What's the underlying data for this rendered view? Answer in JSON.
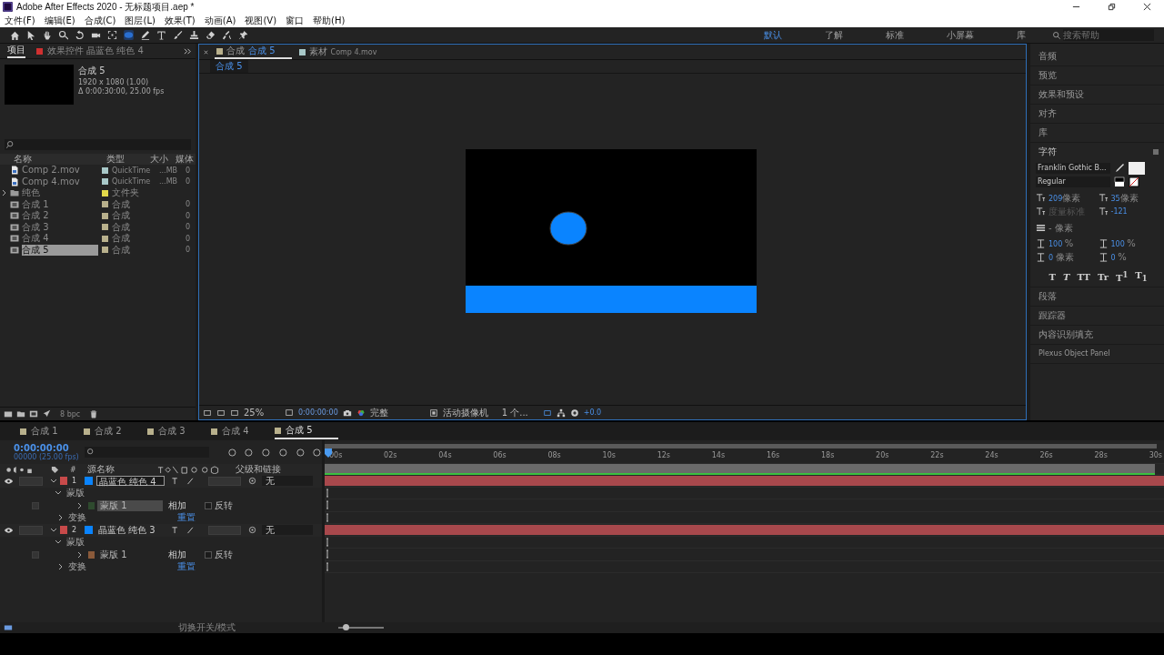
{
  "window": {
    "title": "Adobe After Effects 2020 - 无标题项目.aep *"
  },
  "menu": [
    "文件(F)",
    "编辑(E)",
    "合成(C)",
    "图层(L)",
    "效果(T)",
    "动画(A)",
    "视图(V)",
    "窗口",
    "帮助(H)"
  ],
  "workspaces": [
    {
      "label": "默认",
      "selected": true
    },
    {
      "label": "了解",
      "selected": false
    },
    {
      "label": "标准",
      "selected": false
    },
    {
      "label": "小屏幕",
      "selected": false
    },
    {
      "label": "库",
      "selected": false
    }
  ],
  "help_search": {
    "placeholder": "搜索帮助"
  },
  "project": {
    "tabs": [
      {
        "label": "项目",
        "selected": true
      },
      {
        "label": "效果控件 晶蓝色 纯色 4",
        "selected": false
      }
    ],
    "preview": {
      "name": "合成 5",
      "size": "1920 x 1080 (1.00)",
      "duration": "Δ 0:00:30:00, 25.00 fps"
    },
    "columns": [
      "名称",
      "类型",
      "大小",
      "媒体"
    ],
    "items": [
      {
        "kind": "footage",
        "name": "Comp 2.mov",
        "type": "QuickTime",
        "size": "...MB",
        "media": "0",
        "color": "#a8c8c8",
        "selected": false
      },
      {
        "kind": "footage",
        "name": "Comp 4.mov",
        "type": "QuickTime",
        "size": "...MB",
        "media": "0",
        "color": "#a8c8c8",
        "selected": false
      },
      {
        "kind": "folder",
        "name": "纯色",
        "type": "文件夹",
        "color": "#e2d84a",
        "selected": false
      },
      {
        "kind": "comp",
        "name": "合成 1",
        "type": "合成",
        "media": "0",
        "color": "#b8b08c",
        "selected": false
      },
      {
        "kind": "comp",
        "name": "合成 2",
        "type": "合成",
        "media": "0",
        "color": "#b8b08c",
        "selected": false
      },
      {
        "kind": "comp",
        "name": "合成 3",
        "type": "合成",
        "media": "0",
        "color": "#b8b08c",
        "selected": false
      },
      {
        "kind": "comp",
        "name": "合成 4",
        "type": "合成",
        "media": "0",
        "color": "#b8b08c",
        "selected": false
      },
      {
        "kind": "comp",
        "name": "合成 5",
        "type": "合成",
        "media": "0",
        "color": "#b8b08c",
        "selected": true
      }
    ],
    "bpc": "8 bpc"
  },
  "viewer": {
    "tabs": [
      {
        "type": "合成",
        "label": "合成 5",
        "selected": true
      },
      {
        "type": "素材",
        "label": "Comp 4.mov",
        "selected": false
      }
    ],
    "breadcrumb": "合成 5",
    "zoom": "25%",
    "time": "0:00:00:00",
    "resolution": "完整",
    "camera": "活动摄像机",
    "views": "1 个...",
    "exposure": "+0.0"
  },
  "right": {
    "top_panels": [
      "音频",
      "预览",
      "效果和预设",
      "对齐",
      "库"
    ],
    "character": {
      "title": "字符",
      "font": "Franklin Gothic B...",
      "style": "Regular",
      "size": {
        "value": "209",
        "unit": "像素"
      },
      "leading": {
        "value": "35",
        "unit": "像素"
      },
      "kerning": {
        "unit": "度量标准"
      },
      "tracking": {
        "value": "-121"
      },
      "stroke": {
        "value": "-",
        "unit": "像素"
      },
      "vscale": {
        "value": "100",
        "unit": "%"
      },
      "hscale": {
        "value": "100",
        "unit": "%"
      },
      "baseline": {
        "value": "0",
        "unit": "像素"
      },
      "tsume": {
        "value": "0",
        "unit": "%"
      },
      "styles": [
        "T",
        "T",
        "TT",
        "Tr",
        "T$^{1}$",
        "T$_{1}$"
      ]
    },
    "bottom_panels": [
      "段落",
      "跟踪器",
      "内容识别填充",
      "Plexus Object Panel"
    ]
  },
  "timeline": {
    "tabs": [
      {
        "label": "合成 1",
        "selected": false
      },
      {
        "label": "合成 2",
        "selected": false
      },
      {
        "label": "合成 3",
        "selected": false
      },
      {
        "label": "合成 4",
        "selected": false
      },
      {
        "label": "合成 5",
        "selected": true
      }
    ],
    "timecode": "0:00:00:00",
    "fps": "00000 (25.00 fps)",
    "columns": {
      "num": "#",
      "name": "源名称",
      "parent": "父级和链接"
    },
    "ticks": [
      "00s",
      "02s",
      "04s",
      "06s",
      "08s",
      "10s",
      "12s",
      "14s",
      "16s",
      "18s",
      "20s",
      "22s",
      "24s",
      "26s",
      "28s",
      "30s"
    ],
    "layers": [
      {
        "num": "1",
        "name": "晶蓝色 纯色 4",
        "selected": true,
        "parent": "无",
        "mask_group": "蒙版",
        "transform": "变换",
        "reset": "重置",
        "masks": [
          {
            "name": "蒙版 1",
            "color": "#2e4a2e",
            "mode": "相加",
            "invert": "反转",
            "invert_checked": false,
            "selected": true
          }
        ]
      },
      {
        "num": "2",
        "name": "晶蓝色 纯色 3",
        "selected": false,
        "parent": "无",
        "mask_group": "蒙版",
        "transform": "变换",
        "reset": "重置",
        "masks": [
          {
            "name": "蒙版 1",
            "color": "#8a5a3a",
            "mode": "相加",
            "invert": "反转",
            "invert_checked": false,
            "selected": false
          }
        ]
      }
    ],
    "status": "切换开关/模式",
    "zoom": {
      "level": 0.15
    }
  }
}
